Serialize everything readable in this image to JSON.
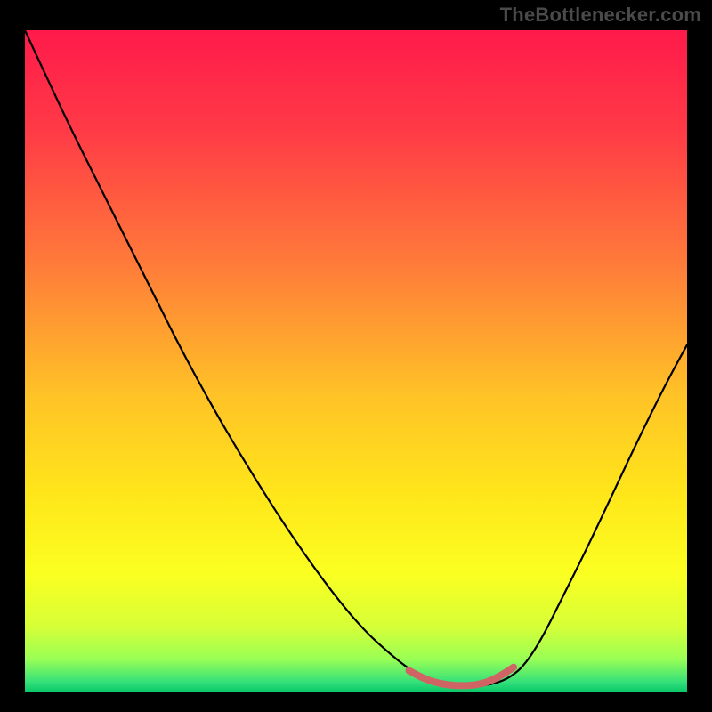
{
  "watermark": {
    "text": "TheBottlenecker.com"
  },
  "chart_data": {
    "type": "line",
    "title": "",
    "xlabel": "",
    "ylabel": "",
    "xlim": [
      0,
      100
    ],
    "ylim": [
      0,
      100
    ],
    "background_gradient": {
      "stops": [
        {
          "offset": 0.0,
          "color": "#ff1a4b"
        },
        {
          "offset": 0.15,
          "color": "#ff3a46"
        },
        {
          "offset": 0.35,
          "color": "#ff7a3a"
        },
        {
          "offset": 0.55,
          "color": "#ffc227"
        },
        {
          "offset": 0.7,
          "color": "#ffe61a"
        },
        {
          "offset": 0.82,
          "color": "#fbff21"
        },
        {
          "offset": 0.9,
          "color": "#d7ff37"
        },
        {
          "offset": 0.95,
          "color": "#99ff55"
        },
        {
          "offset": 0.985,
          "color": "#33e07a"
        },
        {
          "offset": 1.0,
          "color": "#07c567"
        }
      ]
    },
    "series": [
      {
        "name": "bottleneck-curve",
        "color": "#000000",
        "width": 2.2,
        "x": [
          0.0,
          3.0,
          7.0,
          12.0,
          18.0,
          25.0,
          33.0,
          42.0,
          50.0,
          56.0,
          60.0,
          62.5,
          65.0,
          68.0,
          71.0,
          73.5,
          75.5,
          78.0,
          81.0,
          85.0,
          89.0,
          93.0,
          97.0,
          100.0
        ],
        "y": [
          100.0,
          93.5,
          85.0,
          75.0,
          63.0,
          49.0,
          35.0,
          21.0,
          10.5,
          5.0,
          2.2,
          1.2,
          0.9,
          0.9,
          1.3,
          2.4,
          4.2,
          8.0,
          14.0,
          22.0,
          30.5,
          39.0,
          47.0,
          52.5
        ]
      },
      {
        "name": "optimal-zone-marker",
        "color": "#d06464",
        "width": 8,
        "x": [
          58.0,
          60.0,
          62.0,
          64.0,
          66.0,
          68.0,
          70.0,
          72.0,
          73.8
        ],
        "y": [
          3.3,
          2.2,
          1.5,
          1.1,
          1.0,
          1.1,
          1.6,
          2.6,
          3.8
        ]
      }
    ]
  }
}
